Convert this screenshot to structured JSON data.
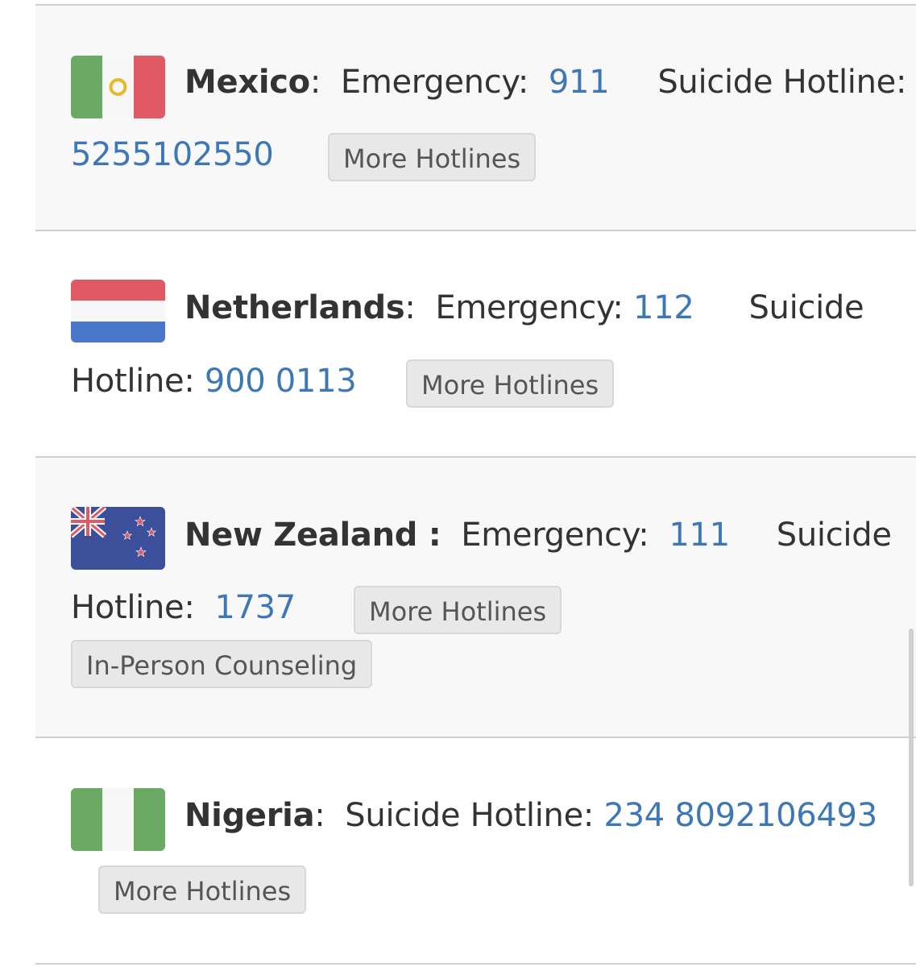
{
  "rows": [
    {
      "country": "Mexico",
      "emergency_label": "Emergency:",
      "emergency_number": "911",
      "suicide_label": "Suicide Hotline:",
      "hotline_number": "5255102550",
      "more_button": "More Hotlines",
      "flag_colors": [
        "#6aaa64",
        "#f7f7f7",
        "#e05a63"
      ]
    },
    {
      "country": "Netherlands",
      "emergency_label": "Emergency:",
      "emergency_number": "112",
      "suicide_label_a": "Suicide",
      "suicide_label_b": "Hotline:",
      "hotline_number": "900 0113",
      "more_button": "More Hotlines",
      "flag_colors": [
        "#e05a63",
        "#f7f7f7",
        "#4a77c9"
      ]
    },
    {
      "country": "New Zealand",
      "emergency_label": "Emergency:",
      "emergency_number": "111",
      "suicide_label_a": "Suicide",
      "suicide_label_b": "Hotline:",
      "hotline_number": "1737",
      "more_button": "More Hotlines",
      "counseling_button": "In-Person Counseling",
      "flag_colors": [
        "#3b4f9b",
        "#e05a63",
        "#ffffff"
      ]
    },
    {
      "country": "Nigeria",
      "suicide_label": "Suicide Hotline:",
      "hotline_number": "234 8092106493",
      "more_button": "More Hotlines",
      "flag_colors": [
        "#6aaa64",
        "#f7f7f7",
        "#6aaa64"
      ]
    }
  ]
}
